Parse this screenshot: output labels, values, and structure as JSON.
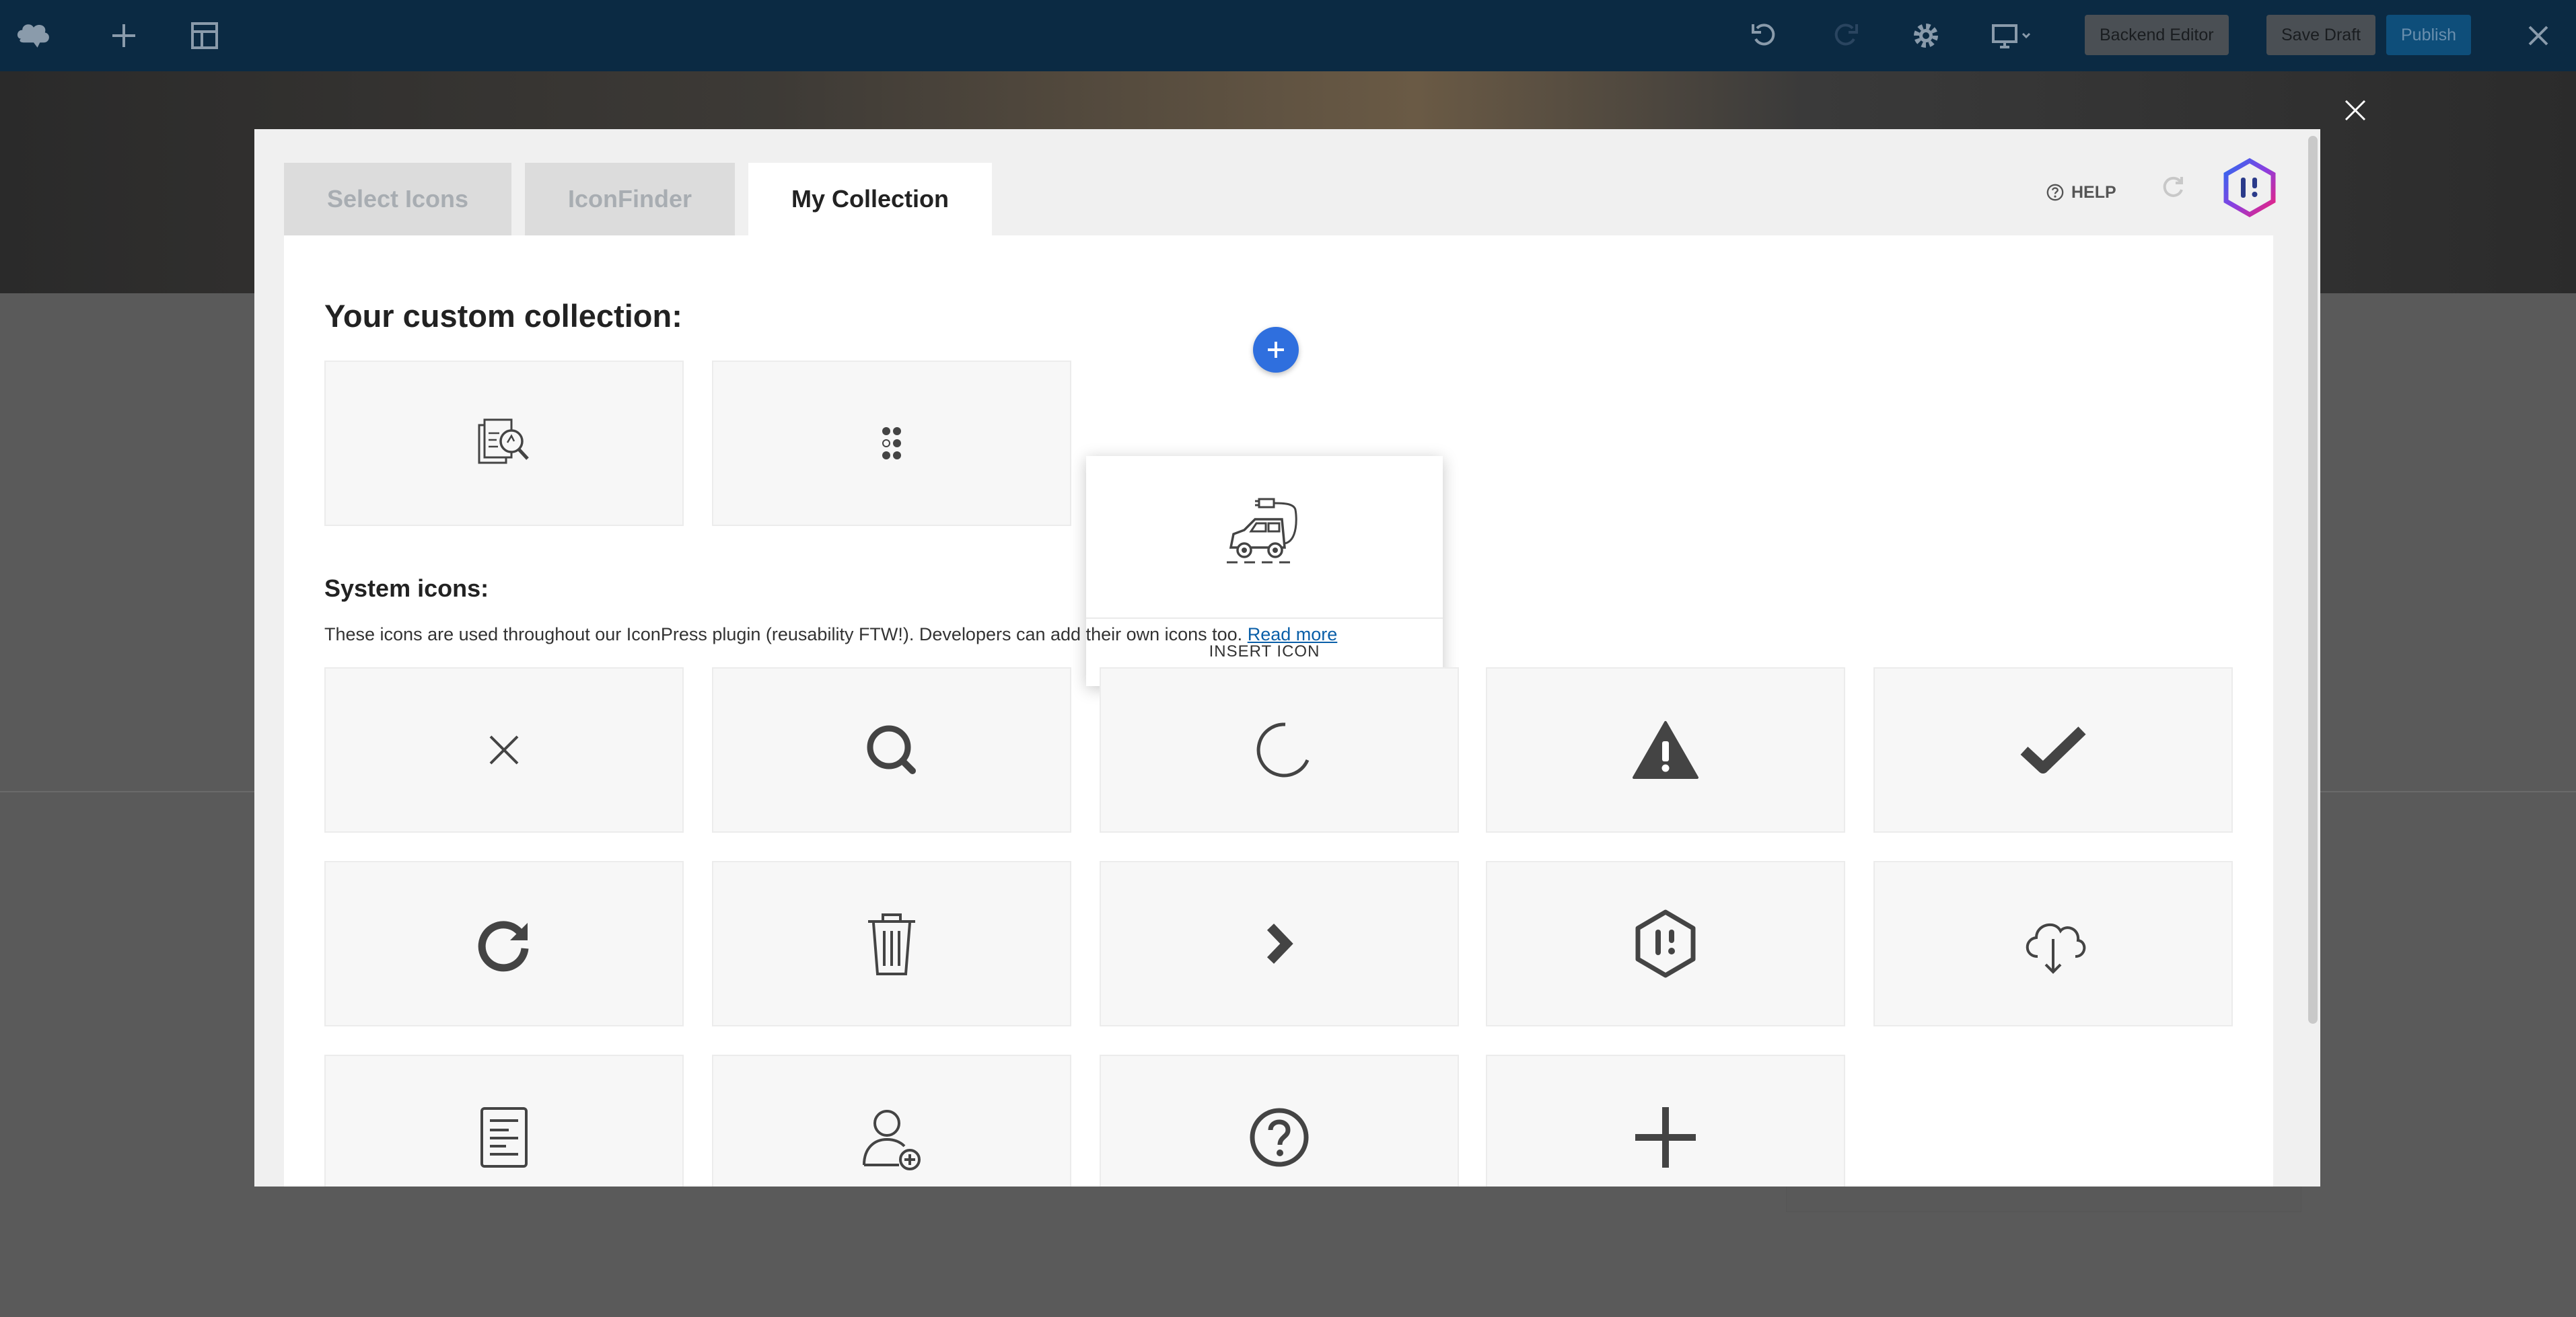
{
  "topbar": {
    "buttons": {
      "backend_editor": "Backend Editor",
      "save_draft": "Save Draft",
      "publish": "Publish"
    },
    "icons": [
      "wpbakery-logo-icon",
      "add-element-icon",
      "templates-icon",
      "undo-icon",
      "redo-icon",
      "settings-icon",
      "responsive-preview-icon",
      "close-editor-icon"
    ]
  },
  "modal": {
    "tabs": [
      {
        "label": "Select Icons",
        "active": false
      },
      {
        "label": "IconFinder",
        "active": false
      },
      {
        "label": "My Collection",
        "active": true
      }
    ],
    "help_label": "HELP",
    "custom_heading": "Your custom collection:",
    "custom_icons": [
      "report-search-icon",
      "dots-grid-icon",
      "electric-car-icon"
    ],
    "popup": {
      "icon": "electric-car-icon",
      "insert_label": "INSERT ICON"
    },
    "system_heading": "System icons:",
    "system_description": "These icons are used throughout our IconPress plugin (reusability FTW!). Developers can add their own icons too.",
    "read_more": "Read more",
    "system_icons": [
      "close-icon",
      "search-icon",
      "loading-spinner-icon",
      "warning-icon",
      "checkmark-icon",
      "refresh-icon",
      "trash-icon",
      "chevron-right-icon",
      "iconpress-logo-icon",
      "cloud-download-icon",
      "document-icon",
      "add-user-icon",
      "help-circle-icon",
      "plus-icon"
    ]
  },
  "colors": {
    "topbar_bg": "#0b2a43",
    "accent_blue": "#2f6fde",
    "link_blue": "#0a5fa8"
  }
}
